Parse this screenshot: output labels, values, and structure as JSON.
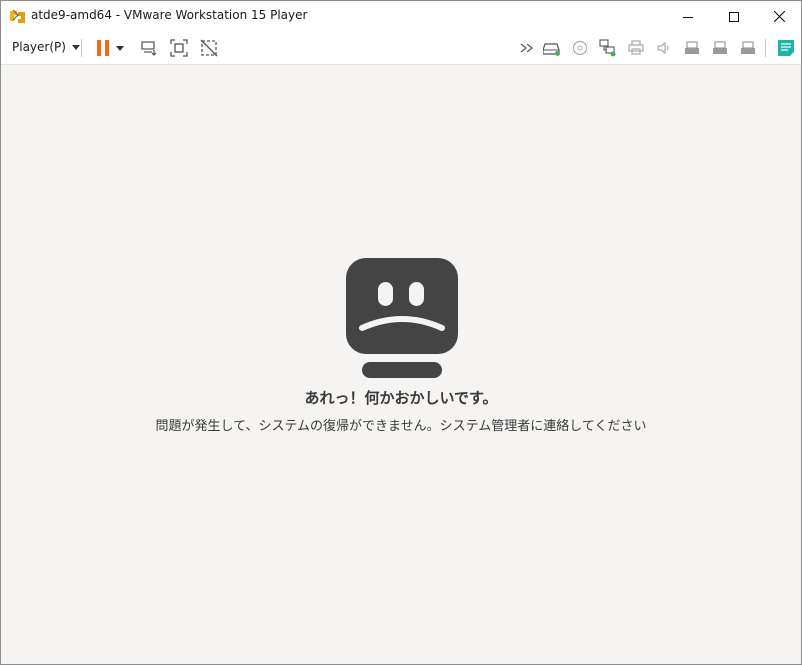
{
  "window": {
    "title": "atde9-amd64 - VMware Workstation 15 Player"
  },
  "toolbar": {
    "player_menu_label": "Player(P)"
  },
  "error": {
    "title": "あれっ！何かおかしいです。",
    "message": "問題が発生して、システムの復帰ができません。システム管理者に連絡してください"
  },
  "colors": {
    "pause_orange": "#f06a1a",
    "device_green": "#4caf50",
    "notes_teal": "#1fb5a8",
    "face_dark": "#444444"
  }
}
